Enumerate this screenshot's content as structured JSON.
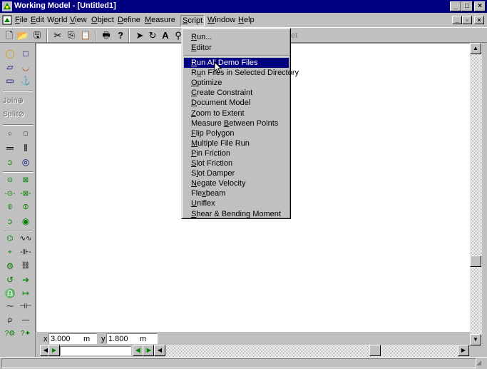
{
  "window": {
    "title": "Working Model - [Untitled1]"
  },
  "menubar": {
    "items": [
      {
        "label": "File",
        "key": "F"
      },
      {
        "label": "Edit",
        "key": "E"
      },
      {
        "label": "World",
        "key": "o"
      },
      {
        "label": "View",
        "key": "V"
      },
      {
        "label": "Object",
        "key": "O"
      },
      {
        "label": "Define",
        "key": "D"
      },
      {
        "label": "Measure",
        "key": "M"
      },
      {
        "label": "Script",
        "key": "S"
      },
      {
        "label": "Window",
        "key": "W"
      },
      {
        "label": "Help",
        "key": "H"
      }
    ],
    "active": "Script"
  },
  "script_menu": {
    "top_items": [
      "Run...",
      "Editor"
    ],
    "items": [
      "Run All Demo Files",
      "Run Files in Selected Directory",
      "Optimize",
      "Create Constraint",
      "Document Model",
      "Zoom to Extent",
      "Measure Between Points",
      "Flip Polygon",
      "Multiple File Run",
      "Pin Friction",
      "Slot Friction",
      "Slot Damper",
      "Negate Velocity",
      "Flexbeam",
      "Uniflex",
      "Shear & Bending Moment"
    ],
    "highlighted": "Run All Demo Files"
  },
  "toolbar": {
    "partial_label": "et"
  },
  "left_panel": {
    "join_label": "Join",
    "split_label": "Split"
  },
  "coords": {
    "x_label": "x",
    "x_value": "3.000",
    "x_unit": "m",
    "y_label": "y",
    "y_value": "1.800",
    "y_unit": "m"
  },
  "colors": {
    "titlebar": "#000080",
    "highlight": "#000080",
    "face": "#c0c0c0"
  }
}
